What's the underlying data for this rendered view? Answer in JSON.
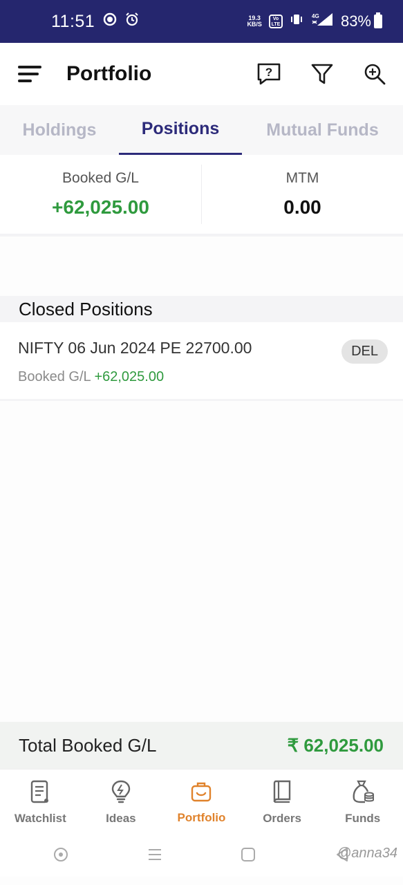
{
  "status_bar": {
    "time": "11:51",
    "net_speed_top": "19.3",
    "net_speed_bottom": "KB/S",
    "volte_top": "Vo",
    "volte_bottom": "LTE",
    "network": "4G",
    "battery": "83%"
  },
  "header": {
    "title": "Portfolio",
    "icons": [
      "menu-icon",
      "help-chat-icon",
      "filter-icon",
      "search-add-icon"
    ]
  },
  "tabs": [
    {
      "label": "Holdings",
      "active": false
    },
    {
      "label": "Positions",
      "active": true
    },
    {
      "label": "Mutual Funds",
      "active": false
    }
  ],
  "summary": {
    "booked_label": "Booked G/L",
    "booked_value": "+62,025.00",
    "mtm_label": "MTM",
    "mtm_value": "0.00"
  },
  "closed_positions": {
    "title": "Closed Positions",
    "items": [
      {
        "name": "NIFTY 06 Jun 2024 PE 22700.00",
        "badge": "DEL",
        "booked_label": "Booked G/L",
        "booked_value": "+62,025.00"
      }
    ]
  },
  "total": {
    "label": "Total Booked G/L",
    "value": "₹ 62,025.00"
  },
  "bottom_nav": [
    {
      "label": "Watchlist",
      "icon": "watchlist-icon",
      "active": false
    },
    {
      "label": "Ideas",
      "icon": "ideas-bulb-icon",
      "active": false
    },
    {
      "label": "Portfolio",
      "icon": "portfolio-bag-icon",
      "active": true
    },
    {
      "label": "Orders",
      "icon": "orders-book-icon",
      "active": false
    },
    {
      "label": "Funds",
      "icon": "funds-bag-icon",
      "active": false
    }
  ],
  "watermark": "@anna34",
  "colors": {
    "status_bar": "#25266e",
    "accent_tab": "#2d2b7a",
    "gain_green": "#2f9a3e",
    "nav_active": "#e0822b"
  }
}
